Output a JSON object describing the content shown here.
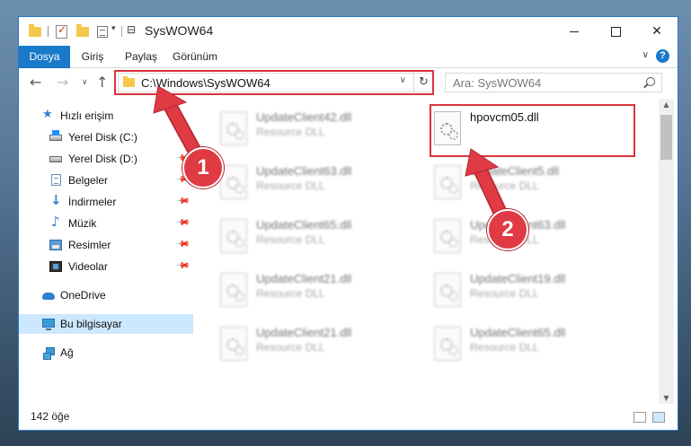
{
  "window": {
    "title": "SysWOW64",
    "controls": {
      "minimize": "—",
      "maximize": "☐",
      "close": "✕"
    }
  },
  "ribbon": {
    "tabs": [
      "Dosya",
      "Giriş",
      "Paylaş",
      "Görünüm"
    ],
    "help": "?"
  },
  "navigation": {
    "back": "←",
    "forward": "→",
    "recent": "∨",
    "up": "↑",
    "address": "C:\\Windows\\SysWOW64",
    "refresh": "↻",
    "search_placeholder": "Ara: SysWOW64"
  },
  "sidebar": {
    "items": [
      {
        "label": "Hızlı erişim",
        "icon": "star-icon"
      },
      {
        "label": "Yerel Disk (C:)",
        "icon": "drive-icon",
        "pinned": true
      },
      {
        "label": "Yerel Disk (D:)",
        "icon": "drive-icon",
        "pinned": true
      },
      {
        "label": "Belgeler",
        "icon": "documents-icon",
        "pinned": true
      },
      {
        "label": "İndirmeler",
        "icon": "downloads-icon",
        "pinned": true
      },
      {
        "label": "Müzik",
        "icon": "music-icon",
        "pinned": true
      },
      {
        "label": "Resimler",
        "icon": "pictures-icon",
        "pinned": true
      },
      {
        "label": "Videolar",
        "icon": "videos-icon",
        "pinned": true
      },
      {
        "label": "OneDrive",
        "icon": "cloud-icon"
      },
      {
        "label": "Bu bilgisayar",
        "icon": "computer-icon",
        "selected": true
      },
      {
        "label": "Ağ",
        "icon": "network-icon"
      }
    ]
  },
  "files": [
    {
      "name": "UpdateClient42.dll",
      "type": "Resource DLL",
      "blurred": true
    },
    {
      "name": "hpovcm05.dll",
      "type": "",
      "blurred": false,
      "highlighted": true
    },
    {
      "name": "UpdateClient63.dll",
      "type": "Resource DLL",
      "blurred": true
    },
    {
      "name": "UpdateClient5.dll",
      "type": "Resource DLL",
      "blurred": true
    },
    {
      "name": "UpdateClient65.dll",
      "type": "Resource DLL",
      "blurred": true
    },
    {
      "name": "UpdateClient63.dll",
      "type": "Resource DLL",
      "blurred": true
    },
    {
      "name": "UpdateClient21.dll",
      "type": "Resource DLL",
      "blurred": true
    },
    {
      "name": "UpdateClient19.dll",
      "type": "Resource DLL",
      "blurred": true
    },
    {
      "name": "UpdateClient21.dll",
      "type": "Resource DLL",
      "blurred": true
    },
    {
      "name": "UpdateClient65.dll",
      "type": "Resource DLL",
      "blurred": true
    }
  ],
  "status": {
    "item_count": "142 öğe"
  },
  "callouts": {
    "first": "1",
    "second": "2"
  },
  "colors": {
    "accent": "#1979ca",
    "callout": "#e03a44",
    "selection": "#cce8ff"
  }
}
